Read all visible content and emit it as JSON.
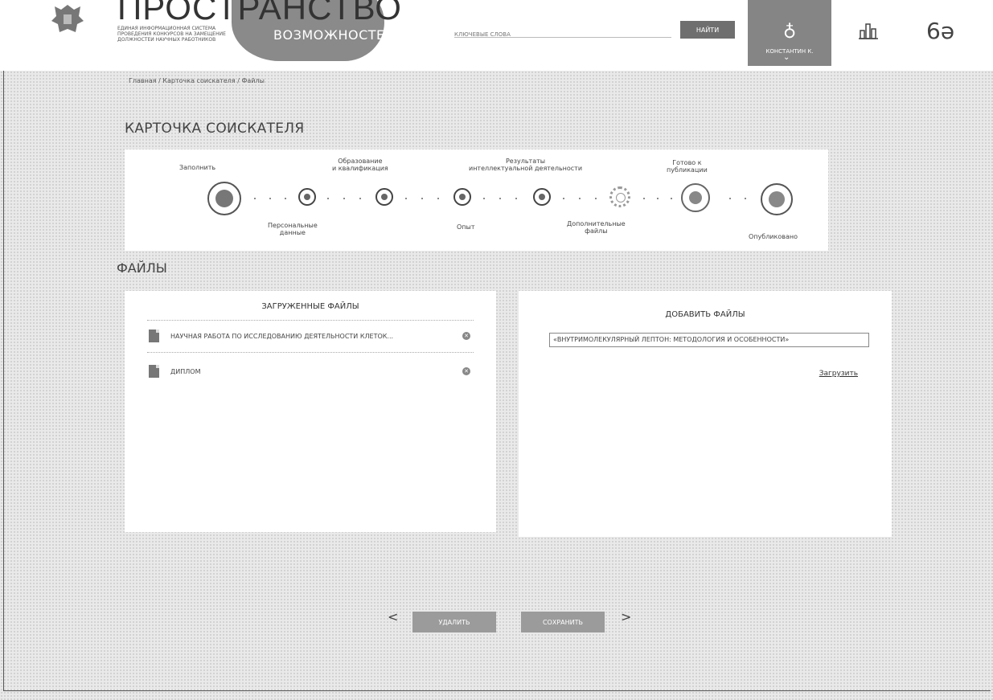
{
  "header": {
    "logo_title": "ПРОСТРАНСТВО",
    "logo_word": "ВОЗМОЖНОСТЕЙ",
    "logo_subtitle": [
      "ЕДИНАЯ ИНФОРМАЦИОННАЯ СИСТЕМА",
      "ПРОВЕДЕНИЯ КОНКУРСОВ НА ЗАМЕЩЕНИЕ",
      "ДОЛЖНОСТЕЙ НАУЧНЫХ РАБОТНИКОВ"
    ],
    "search_placeholder": "КЛЮЧЕВЫЕ СЛОВА",
    "find_button": "НАЙТИ",
    "user_name": "КОНСТАНТИН К."
  },
  "breadcrumb": "Главная / Карточка соискателя / Файлы",
  "page_title": "КАРТОЧКА СОИСКАТЕЛЯ",
  "steps": {
    "top_labels": [
      "Заполнить",
      "Образование\nи квалификация",
      "Результаты\nинтеллектуальной деятельности",
      "Готово к\nпубликации"
    ],
    "bottom_labels": [
      "Персональные\nданные",
      "Опыт",
      "Дополнительные\nфайлы",
      "Опубликовано"
    ]
  },
  "files_section_title": "ФАЙЛЫ",
  "uploaded": {
    "title": "ЗАГРУЖЕННЫЕ ФАЙЛЫ",
    "files": [
      "НАУЧНАЯ РАБОТА ПО ИССЛЕДОВАНИЮ ДЕЯТЕЛЬНОСТИ КЛЕТОК...",
      "ДИПЛОМ"
    ]
  },
  "add_files": {
    "title": "ДОБАВИТЬ ФАЙЛЫ",
    "field_value": "«ВНУТРИМОЛЕКУЛЯРНЫЙ ЛЕПТОН: МЕТОДОЛОГИЯ И ОСОБЕННОСТИ»",
    "upload_link": "Загрузить"
  },
  "footer": {
    "delete_button": "УДАЛИТЬ",
    "save_button": "СОХРАНИТЬ"
  },
  "icons": {
    "emblem": "coat-of-arms-icon",
    "user": "user-icon",
    "stats": "bar-chart-icon",
    "glasses": "glasses-icon",
    "file": "document-icon",
    "remove": "remove-icon",
    "prev": "chevron-left-icon",
    "next": "chevron-right-icon"
  },
  "colors": {
    "accent_dark": "#6f6f6f",
    "accent_mid": "#858585",
    "button": "#9b9b9b",
    "panel": "#ffffff"
  }
}
